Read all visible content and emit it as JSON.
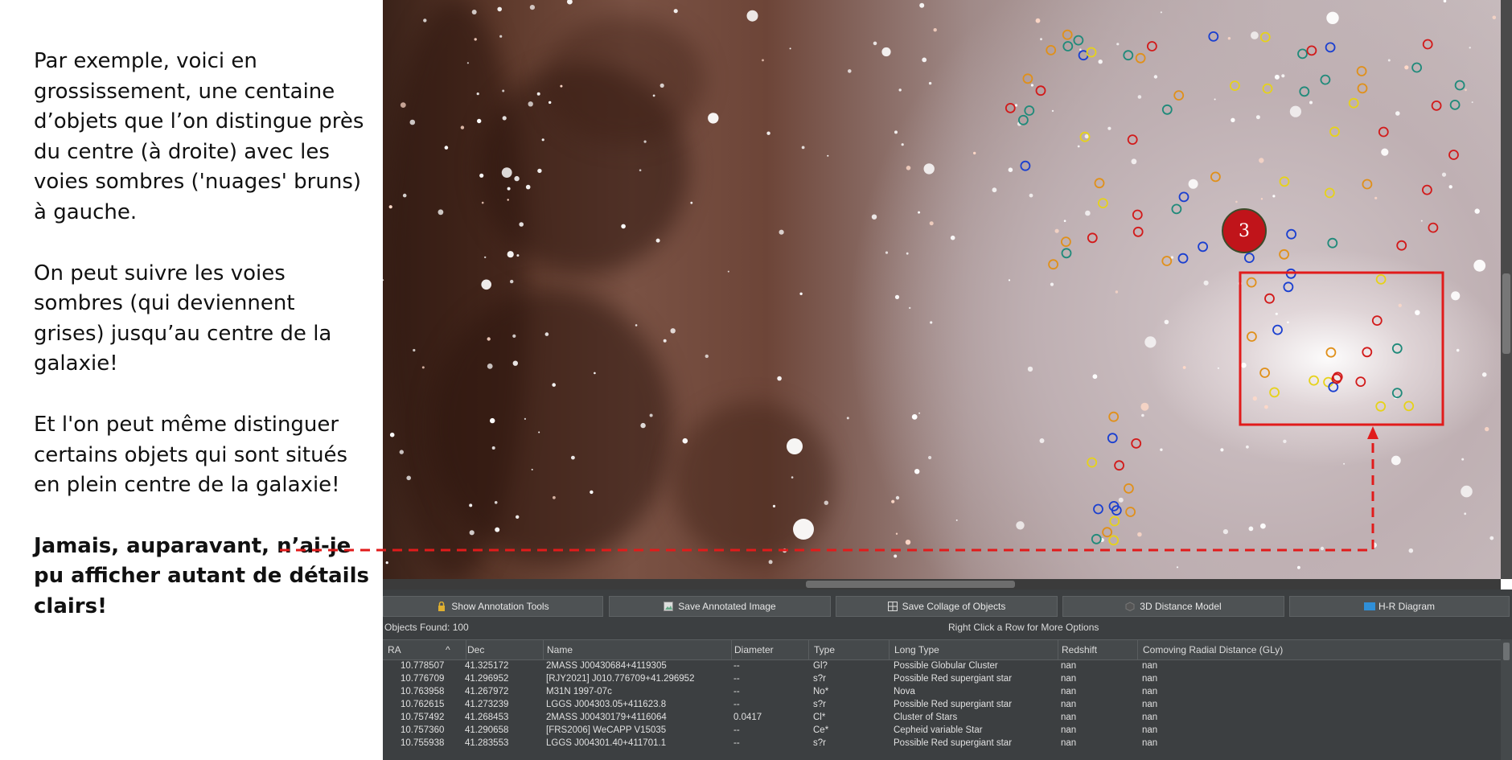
{
  "caption": {
    "p1": "Par exemple, voici en grossissement, une centaine d’objets que l’on distingue près du centre (à droite) avec les voies sombres ('nuages' bruns) à gauche.",
    "p2": "On peut suivre les voies sombres (qui deviennent grises) jusqu’au centre de la galaxie!",
    "p3": "Et l'on peut même distinguer certains objets qui sont situés en plein centre de la galaxie!",
    "p4": "Jamais, auparavant, n’ai-je pu afficher autant de détails clairs!"
  },
  "viewer": {
    "marker_label": "3",
    "highlight_color": "#e11b1b"
  },
  "toolbar": {
    "annotation_tools": "Show Annotation Tools",
    "save_annotated": "Save Annotated Image",
    "save_collage": "Save Collage of Objects",
    "distance_model": "3D Distance Model",
    "hr_diagram": "H-R Diagram"
  },
  "status": {
    "objects_found": "Objects Found: 100",
    "hint": "Right Click a Row for More Options"
  },
  "table": {
    "headers": {
      "ra": "RA",
      "dec": "Dec",
      "name": "Name",
      "diameter": "Diameter",
      "type": "Type",
      "long_type": "Long Type",
      "redshift": "Redshift",
      "distance": "Comoving Radial Distance (GLy)"
    },
    "rows": [
      {
        "ra": "10.778507",
        "dec": "41.325172",
        "name": "2MASS J00430684+4119305",
        "diameter": "--",
        "type": "Gl?",
        "long_type": "Possible Globular Cluster",
        "redshift": "nan",
        "distance": "nan"
      },
      {
        "ra": "10.776709",
        "dec": "41.296952",
        "name": "[RJY2021] J010.776709+41.296952",
        "diameter": "--",
        "type": "s?r",
        "long_type": "Possible Red supergiant star",
        "redshift": "nan",
        "distance": "nan"
      },
      {
        "ra": "10.763958",
        "dec": "41.267972",
        "name": "M31N 1997-07c",
        "diameter": "--",
        "type": "No*",
        "long_type": "Nova",
        "redshift": "nan",
        "distance": "nan"
      },
      {
        "ra": "10.762615",
        "dec": "41.273239",
        "name": "LGGS J004303.05+411623.8",
        "diameter": "--",
        "type": "s?r",
        "long_type": "Possible Red supergiant star",
        "redshift": "nan",
        "distance": "nan"
      },
      {
        "ra": "10.757492",
        "dec": "41.268453",
        "name": "2MASS J00430179+4116064",
        "diameter": "0.0417",
        "type": "Cl*",
        "long_type": "Cluster of Stars",
        "redshift": "nan",
        "distance": "nan"
      },
      {
        "ra": "10.757360",
        "dec": "41.290658",
        "name": "[FRS2006] WeCAPP V15035",
        "diameter": "--",
        "type": "Ce*",
        "long_type": "Cepheid variable Star",
        "redshift": "nan",
        "distance": "nan"
      },
      {
        "ra": "10.755938",
        "dec": "41.283553",
        "name": "LGGS J004301.40+411701.1",
        "diameter": "--",
        "type": "s?r",
        "long_type": "Possible Red supergiant star",
        "redshift": "nan",
        "distance": "nan"
      }
    ]
  }
}
